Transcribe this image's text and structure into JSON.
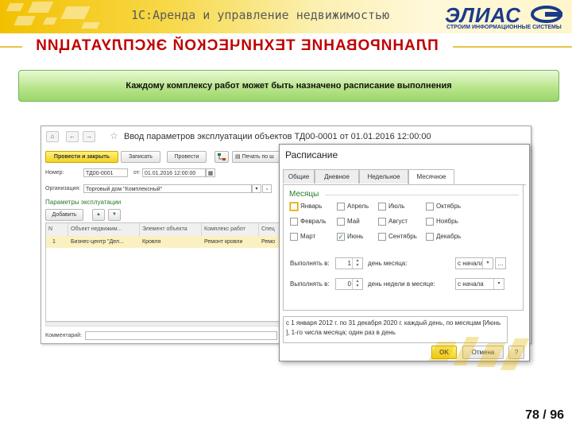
{
  "header": {
    "app_title": "1С:Аренда и управление недвижимостью",
    "logo_text": "ЭЛИАС",
    "logo_subtitle": "СТРОИМ ИНФОРМАЦИОННЫЕ СИСТЕМЫ",
    "heading": "ПЛАНИРОВАНИЕ ТЕХНИЧЕСКОЙ ЭКСПЛУАТАЦИИ",
    "heading_color": "#c00000",
    "accent_color": "#f2c000"
  },
  "banner": {
    "text": "Каждому комплексу работ может быть назначено расписание выполнения",
    "color": "#9bd66a"
  },
  "doc_window": {
    "nav_home": "⌂",
    "nav_back": "←",
    "nav_forward": "→",
    "star": "☆",
    "title": "Ввод параметров эксплуатации объектов ТД00-0001 от 01.01.2016 12:00:00",
    "toolbar": {
      "post_close": "Провести и закрыть",
      "save": "Записать",
      "post": "Провести",
      "print": "Печать по ш"
    },
    "number_label": "Номер:",
    "number_value": "ТД00-0001",
    "date_label": "от:",
    "date_value": "01.01.2016 12:00:00",
    "org_label": "Организация:",
    "org_value": "Торговый дом \"Комплексный\"",
    "params_link": "Параметры эксплуатации",
    "add_button": "Добавить",
    "table": {
      "columns": [
        "N",
        "Объект недвижим...",
        "Элемент объекта",
        "Комплекс работ",
        "Спец"
      ],
      "rows": [
        [
          "1",
          "Бизнес-центр \"Дел...",
          "Кровля",
          "Ремонт кровли",
          "Ремо"
        ]
      ]
    },
    "comment_label": "Комментарий:"
  },
  "dialog": {
    "title": "Расписание",
    "tabs": [
      "Общие",
      "Дневное",
      "Недельное",
      "Месячное"
    ],
    "active_tab": "Месячное",
    "months_title": "Месяцы",
    "months": [
      {
        "label": "Январь",
        "checked": false
      },
      {
        "label": "Апрель",
        "checked": false
      },
      {
        "label": "Июль",
        "checked": false
      },
      {
        "label": "Октябрь",
        "checked": false
      },
      {
        "label": "Февраль",
        "checked": false
      },
      {
        "label": "Май",
        "checked": false
      },
      {
        "label": "Август",
        "checked": false
      },
      {
        "label": "Ноябрь",
        "checked": false
      },
      {
        "label": "Март",
        "checked": false
      },
      {
        "label": "Июнь",
        "checked": true
      },
      {
        "label": "Сентябрь",
        "checked": false
      },
      {
        "label": "Декабрь",
        "checked": false
      }
    ],
    "run_day_label": "Выполнять в:",
    "run_day_value": "1",
    "run_day_unit": "день месяца:",
    "run_day_from": "с начала",
    "run_weekday_label": "Выполнять в:",
    "run_weekday_value": "0",
    "run_weekday_unit": "день недели в месяце:",
    "run_weekday_from": "с начала",
    "summary": "с 1 января 2012 г. по 31 декабря 2020 г. каждый  день, по месяцам  [Июнь ], 1-го числа месяца; один раз в день",
    "ok": "OK",
    "cancel": "Отмена",
    "help": "?"
  },
  "page_number": "78 / 96"
}
